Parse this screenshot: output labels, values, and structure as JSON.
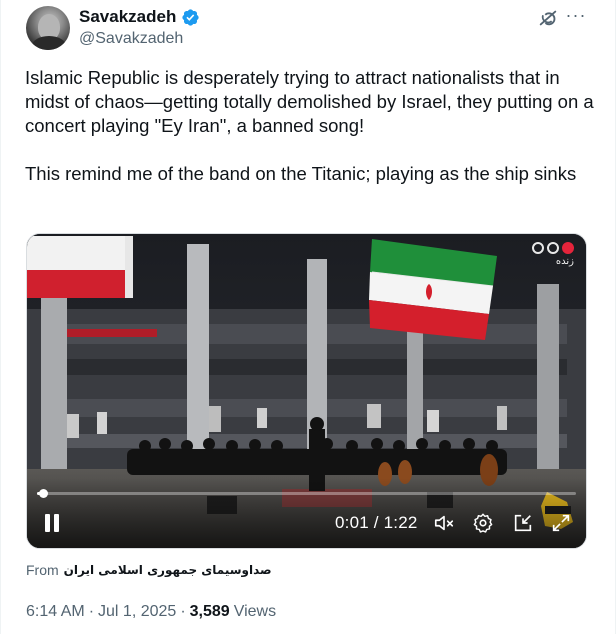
{
  "author": {
    "display_name": "Savakzadeh",
    "handle": "@Savakzadeh",
    "verified": true,
    "verified_color": "#1d9bf0"
  },
  "header_icons": [
    "grok-icon",
    "more-icon"
  ],
  "tweet": {
    "text": "Islamic Republic is desperately trying to attract nationalists that in midst of chaos—getting totally demolished by Israel, they putting on a concert playing \"Ey Iran\", a banned song!\n\nThis remind me of the band on the Titanic; playing as the ship sinks"
  },
  "video": {
    "live_label": "زنده",
    "live_color": "#e5243b",
    "current_time": "0:01",
    "duration": "1:22",
    "time_display": "0:01 / 1:22",
    "progress_fraction": 0.012,
    "controls": [
      "pause-icon",
      "mute-icon",
      "settings-icon",
      "minimize-icon",
      "fullscreen-icon"
    ]
  },
  "attribution": {
    "prefix": "From",
    "source": "صداوسیمای جمهوری اسلامی ایران"
  },
  "meta": {
    "time": "6:14 AM",
    "separator1": "·",
    "date": "Jul 1, 2025",
    "separator2": "·",
    "views_count": "3,589",
    "views_label": "Views"
  }
}
